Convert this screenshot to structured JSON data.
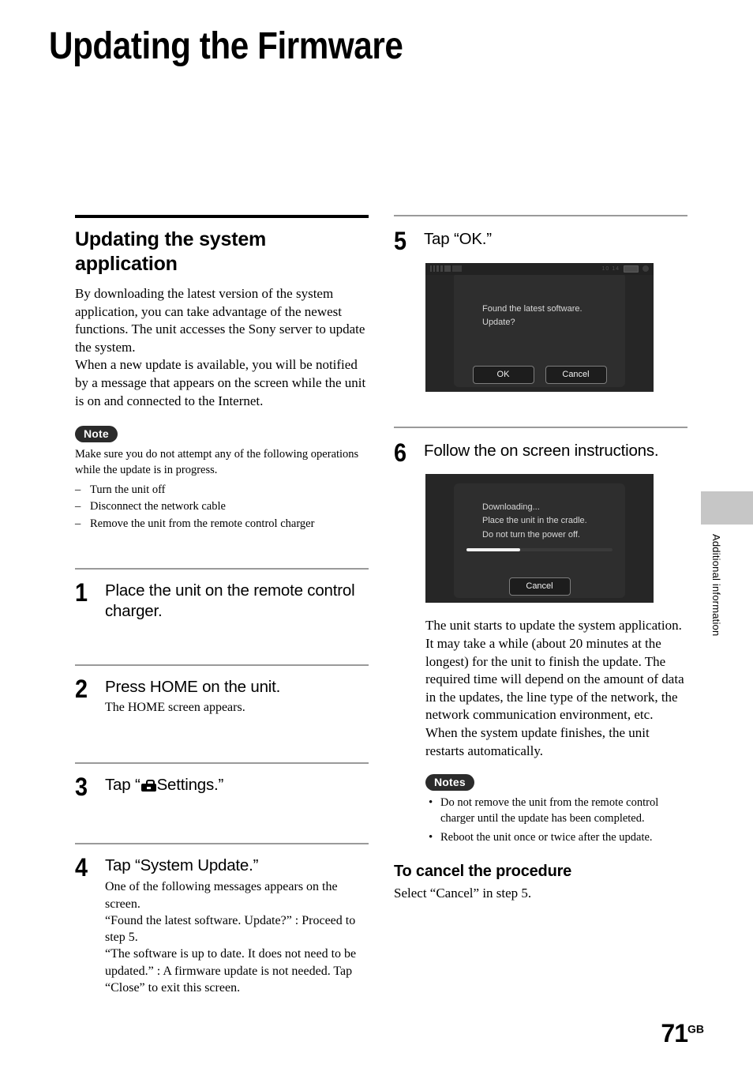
{
  "page": {
    "title": "Updating the Firmware",
    "number": "71",
    "number_suffix": "GB",
    "side_tab_label": "Additional information"
  },
  "left_column": {
    "section_heading": "Updating the system application",
    "intro_paragraph_1": "By downloading the latest version of the system application, you can take advantage of the newest functions. The unit accesses the Sony server to update the system.",
    "intro_paragraph_2": "When a new update is available, you will be notified by a message that appears on the screen while the unit is on and connected to the Internet.",
    "note": {
      "badge": "Note",
      "body": "Make sure you do not attempt any of the following operations while the update is in progress.",
      "items": [
        "Turn the unit off",
        "Disconnect the network cable",
        "Remove the unit from the remote control charger"
      ]
    },
    "steps": [
      {
        "number": "1",
        "title": "Place the unit on the remote control charger.",
        "sub": ""
      },
      {
        "number": "2",
        "title": "Press HOME on the unit.",
        "sub": "The HOME screen appears."
      },
      {
        "number": "3",
        "title_before_icon": "Tap “",
        "icon": "toolbox-icon",
        "title_after_icon": "Settings.”",
        "sub": ""
      },
      {
        "number": "4",
        "title": "Tap “System Update.”",
        "sub": "One of the following messages appears on the screen.\n“Found the latest software. Update?” : Proceed to step 5.\n“The software is up to date. It does not need to be updated.” : A firmware update is not needed. Tap “Close” to exit this screen."
      }
    ]
  },
  "right_column": {
    "steps": [
      {
        "number": "5",
        "title": "Tap “OK.”"
      },
      {
        "number": "6",
        "title": "Follow the on screen instructions."
      }
    ],
    "screenshot_5": {
      "status_time": "10 14",
      "dialog_message": "Found the latest software.\nUpdate?",
      "ok_label": "OK",
      "cancel_label": "Cancel"
    },
    "screenshot_6": {
      "dialog_message": "Downloading...\nPlace the unit in the cradle.\nDo not turn the power off.",
      "progress_percent": 37,
      "cancel_label": "Cancel"
    },
    "after_step6_text": "The unit starts to update the system application. It may take a while (about 20 minutes at the longest) for the unit to finish the update. The required time will depend on the amount of data in the updates, the line type of the network, the network communication environment, etc.\nWhen the system update finishes, the unit restarts automatically.",
    "notes": {
      "badge": "Notes",
      "items": [
        "Do not remove the unit from the remote control charger until the update has been completed.",
        "Reboot the unit once or twice after the update."
      ]
    },
    "cancel_section": {
      "heading": "To cancel the procedure",
      "body": "Select “Cancel” in step 5."
    }
  },
  "colors": {
    "rule_dark": "#000000",
    "rule_light": "#9a9a9a",
    "badge_bg": "#2b2b2b",
    "device_bg": "#262626",
    "side_tab_bg": "#c6c6c6"
  }
}
